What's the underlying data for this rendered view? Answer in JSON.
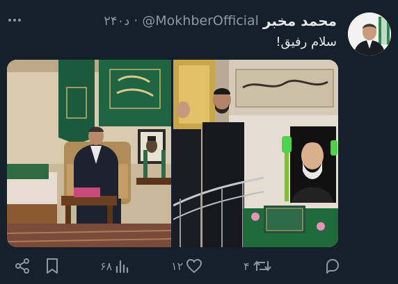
{
  "tweet": {
    "author_name": "محمد مخبر",
    "handle": "@MokhberOfficial",
    "separator": "·",
    "time_ago": "۲۴۰د",
    "text": "سلام رفیق!"
  },
  "actions": {
    "views": "۶۸",
    "likes": "۱۲",
    "retweets": "۴",
    "replies": ""
  },
  "icons": {
    "more": "more-icon",
    "share": "share-icon",
    "bookmark": "bookmark-icon",
    "views": "views-icon",
    "like": "heart-icon",
    "retweet": "retweet-icon",
    "reply": "reply-icon"
  },
  "colors": {
    "background": "#15202b",
    "text_primary": "#e7e9ea",
    "text_secondary": "#8b98a5",
    "banner_green": "#1b5a3c"
  }
}
